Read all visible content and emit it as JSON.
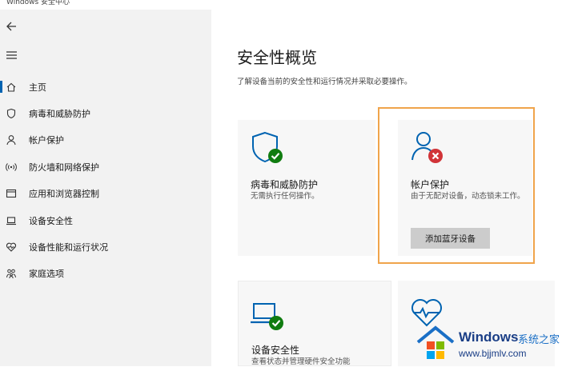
{
  "window": {
    "title": "Windows 安全中心"
  },
  "sidebar": {
    "items": [
      {
        "label": "主页",
        "icon": "home-icon"
      },
      {
        "label": "病毒和威胁防护",
        "icon": "shield-icon"
      },
      {
        "label": "帐户保护",
        "icon": "person-icon"
      },
      {
        "label": "防火墙和网络保护",
        "icon": "wireless-icon"
      },
      {
        "label": "应用和浏览器控制",
        "icon": "app-window-icon"
      },
      {
        "label": "设备安全性",
        "icon": "laptop-icon"
      },
      {
        "label": "设备性能和运行状况",
        "icon": "heart-icon"
      },
      {
        "label": "家庭选项",
        "icon": "family-icon"
      }
    ]
  },
  "main": {
    "title": "安全性概览",
    "subtitle": "了解设备当前的安全性和运行情况并采取必要操作。",
    "cards": [
      {
        "title": "病毒和威胁防护",
        "desc": "无需执行任何操作。",
        "icon": "shield-check-icon"
      },
      {
        "title": "帐户保护",
        "desc": "由于无配对设备，动态锁未工作。",
        "icon": "person-error-icon",
        "action": "添加蓝牙设备"
      },
      {
        "title": "设备安全性",
        "desc": "查看状态并管理硬件安全功能",
        "icon": "laptop-check-icon"
      },
      {
        "title": "",
        "desc": "",
        "icon": "heart-pulse-icon"
      }
    ]
  },
  "watermark": {
    "brand": "Windows",
    "cn": "系统之家",
    "url": "www.bjjmlv.com"
  },
  "colors": {
    "accent": "#0063b1",
    "highlight": "#f0a44b",
    "ok": "#107c10",
    "error": "#d13438"
  }
}
